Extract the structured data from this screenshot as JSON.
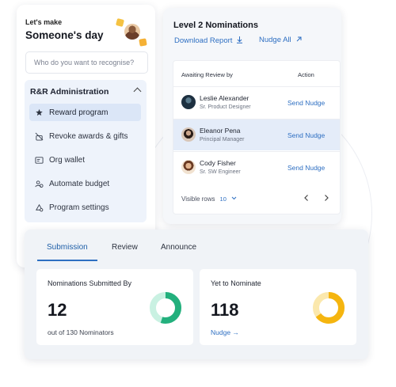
{
  "recognize_card": {
    "eyebrow": "Let's make",
    "title": "Someone's day",
    "search_placeholder": "Who do you want to recognise?"
  },
  "admin": {
    "title": "R&R Administration",
    "items": [
      {
        "label": "Reward program",
        "icon": "gift-star-icon",
        "active": true
      },
      {
        "label": "Revoke awards & gifts",
        "icon": "revoke-icon",
        "active": false
      },
      {
        "label": "Org wallet",
        "icon": "wallet-icon",
        "active": false
      },
      {
        "label": "Automate budget",
        "icon": "users-icon",
        "active": false
      },
      {
        "label": "Program settings",
        "icon": "settings-icon",
        "active": false
      }
    ]
  },
  "nominations": {
    "title": "Level 2 Nominations",
    "download_label": "Download Report",
    "nudge_all_label": "Nudge All",
    "col_awaiting": "Awaiting Review by",
    "col_action": "Action",
    "rows": [
      {
        "name": "Leslie Alexander",
        "role": "Sr. Product Designer",
        "action": "Send Nudge"
      },
      {
        "name": "Eleanor Pena",
        "role": "Principal Manager",
        "action": "Send Nudge"
      },
      {
        "name": "Cody Fisher",
        "role": "Sr. SW Engineer",
        "action": "Send Nudge"
      }
    ],
    "visible_rows_label": "Visible rows",
    "visible_rows_value": "10"
  },
  "bottom": {
    "tabs": [
      "Submission",
      "Review",
      "Announce"
    ],
    "active_tab": "Submission",
    "submitted": {
      "title": "Nominations Submitted By",
      "value": "12",
      "sub": "out of 130 Nominators",
      "donut_fraction": 0.55
    },
    "yet": {
      "title": "Yet to Nominate",
      "value": "118",
      "link": "Nudge →",
      "donut_fraction": 0.65
    }
  },
  "colors": {
    "accent": "#2e6fc2",
    "green": "#23b07d",
    "green_light": "#c9f1e2",
    "yellow": "#f5b50f",
    "yellow_light": "#fbe8ad"
  }
}
